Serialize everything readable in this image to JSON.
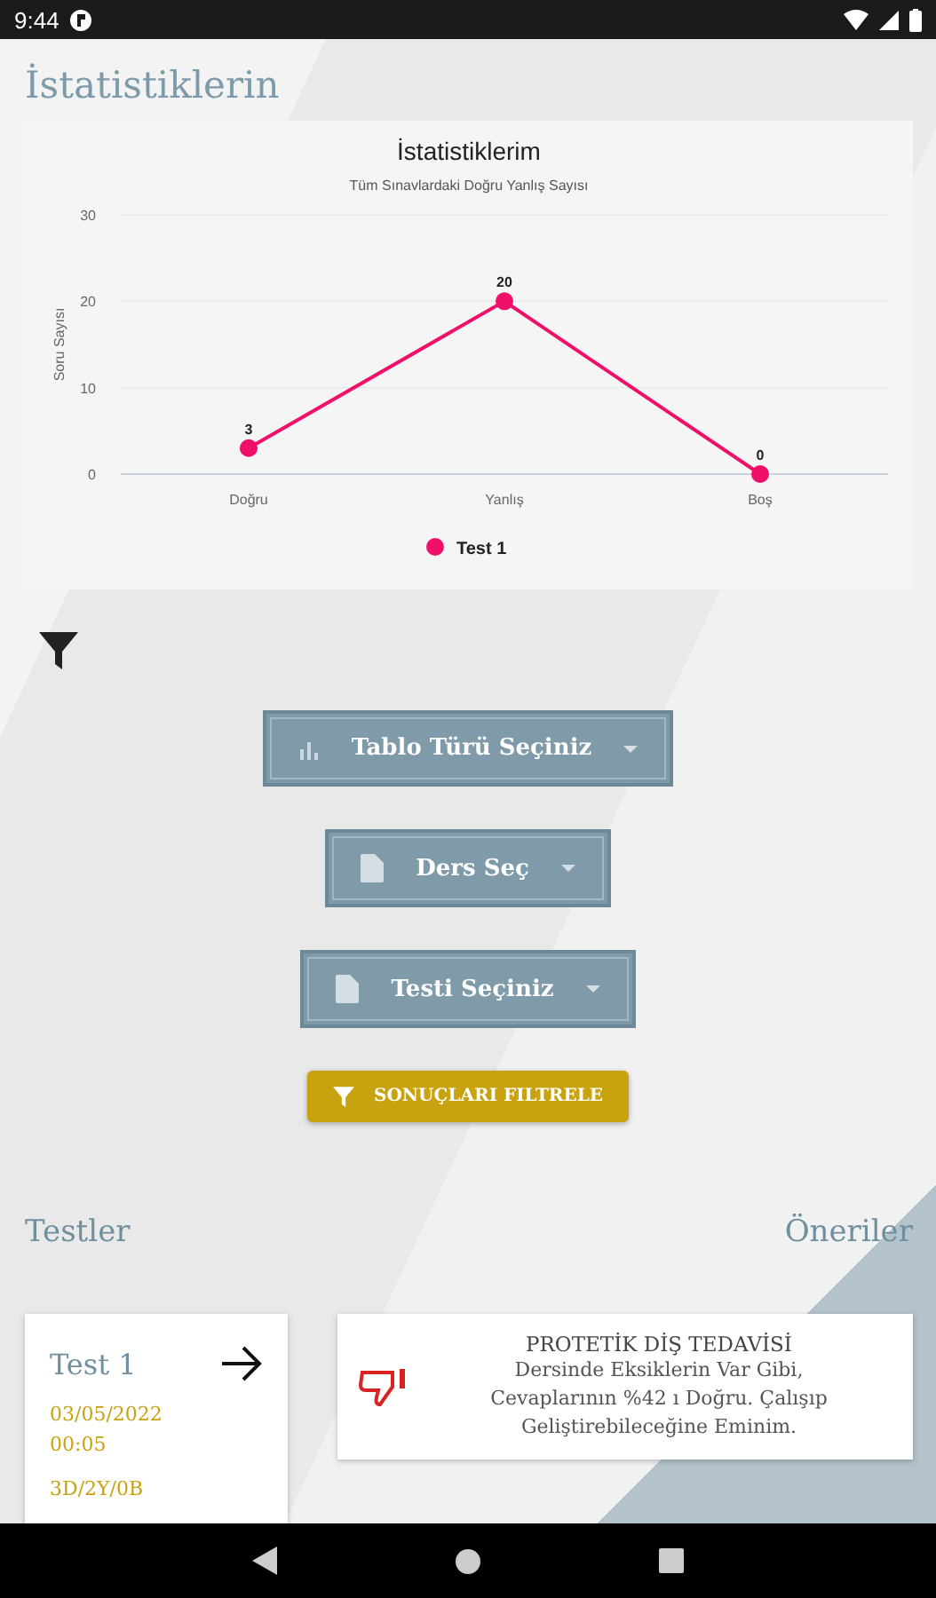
{
  "status_bar": {
    "time": "9:44"
  },
  "title": "İstatistiklerin",
  "chart": {
    "chart_data": {
      "type": "line",
      "title": "İstatistiklerim",
      "subtitle": "Tüm Sınavlardaki Doğru Yanlış Sayısı",
      "ylabel": "Soru Sayısı",
      "categories": [
        "Doğru",
        "Yanlış",
        "Boş"
      ],
      "series": [
        {
          "name": "Test 1",
          "color": "#f0106a",
          "marker": "circle",
          "values": [
            3,
            20,
            0
          ]
        }
      ],
      "ylim": [
        0,
        30
      ],
      "yticks": [
        0,
        10,
        20,
        30
      ],
      "data_labels": true
    }
  },
  "filters": [
    {
      "kind": "chart",
      "label": "Tablo Türü Seçiniz"
    },
    {
      "kind": "doc",
      "label": "Ders Seç"
    },
    {
      "kind": "doc",
      "label": "Testi Seçiniz"
    }
  ],
  "filter_button": "SONUÇLARI FILTRELE",
  "tests_heading": "Testler",
  "suggestions_heading": "Öneriler",
  "test_card": {
    "name": "Test 1",
    "date": "03/05/2022",
    "time": "00:05",
    "score": "3D/2Y/0B"
  },
  "suggestion": {
    "title": "PROTETİK DİŞ TEDAVİSİ",
    "text": "Dersinde Eksiklerin Var Gibi, Cevaplarının  %42 ı Doğru. Çalışıp Geliştirebileceğine Eminim."
  }
}
